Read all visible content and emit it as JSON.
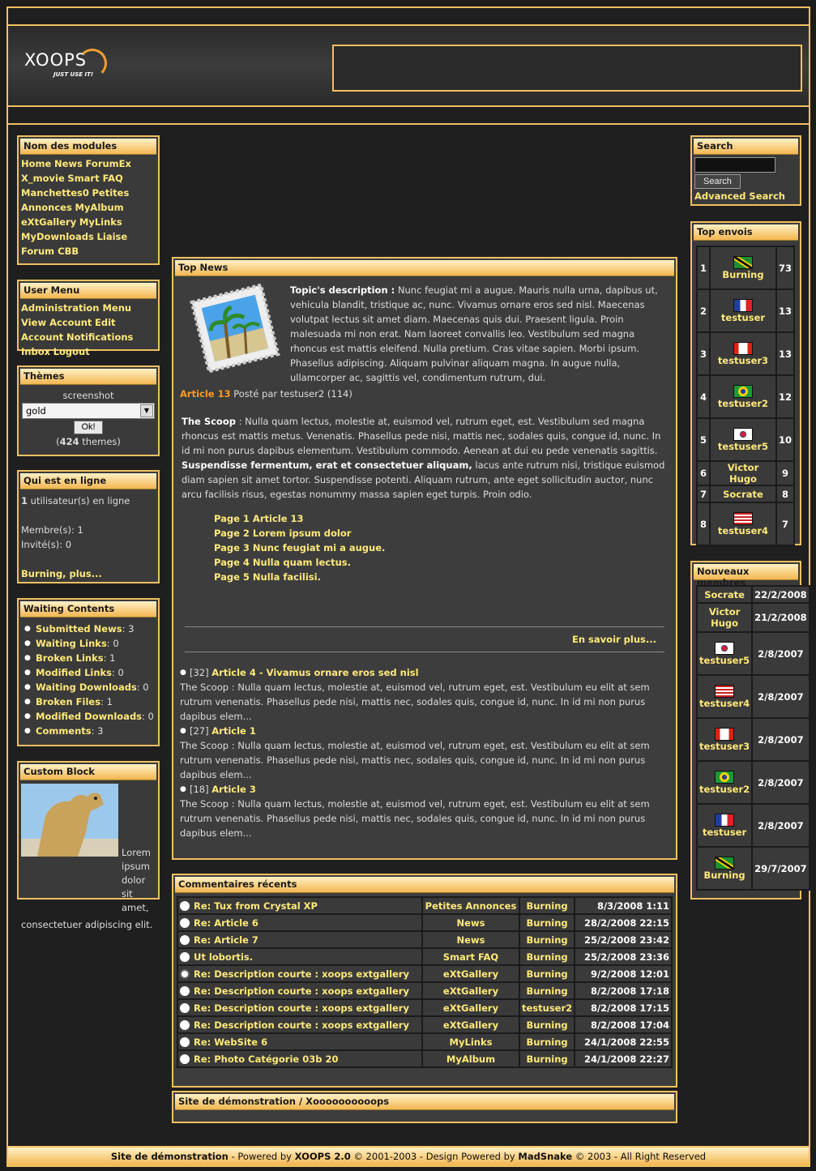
{
  "header": {
    "logo_main": "XOOPS",
    "logo_tag": "JUST USE IT!"
  },
  "modules": {
    "title": "Nom des modules",
    "links": [
      "Home",
      "News",
      "ForumEx",
      "X_movie",
      "Smart FAQ",
      "Manchettes0",
      "Petites Annonces",
      "MyAlbum",
      "eXtGallery",
      "MyLinks",
      "MyDownloads",
      "Liaise",
      "Forum CBB"
    ]
  },
  "user_menu": {
    "title": "User Menu",
    "links": [
      "Administration Menu",
      "View Account",
      "Edit Account",
      "Notifications",
      "Inbox",
      "Logout"
    ]
  },
  "themes": {
    "title": "Thèmes",
    "screenshot_label": "screenshot",
    "selected": "gold",
    "ok_label": "Ok!",
    "count": "424",
    "count_suffix": "themes"
  },
  "online": {
    "title": "Qui est en ligne",
    "count": "1",
    "count_text": "utilisateur(s) en ligne",
    "members": "Membre(s): 1",
    "guests": "Invité(s): 0",
    "more": "Burning, plus..."
  },
  "waiting": {
    "title": "Waiting Contents",
    "items": [
      {
        "label": "Submitted News",
        "value": "3"
      },
      {
        "label": "Waiting Links",
        "value": "0"
      },
      {
        "label": "Broken Links",
        "value": "1"
      },
      {
        "label": "Modified Links",
        "value": "0"
      },
      {
        "label": "Waiting Downloads",
        "value": "0"
      },
      {
        "label": "Broken Files",
        "value": "1"
      },
      {
        "label": "Modified Downloads",
        "value": "0"
      },
      {
        "label": "Comments",
        "value": "3"
      }
    ]
  },
  "custom": {
    "title": "Custom Block",
    "text": "Lorem ipsum dolor sit amet, consectetuer adipiscing elit."
  },
  "top_news": {
    "title": "Top News",
    "topic_label": "Topic's description :",
    "topic_text": "Nunc feugiat mi a augue. Mauris nulla urna, dapibus ut, vehicula blandit, tristique ac, nunc. Vivamus ornare eros sed nisl. Maecenas volutpat lectus sit amet diam. Maecenas quis dui. Praesent ligula. Proin malesuada mi non erat. Nam laoreet convallis leo. Vestibulum sed magna rhoncus est mattis eleifend. Nulla pretium. Cras vitae sapien. Morbi ipsum. Phasellus adipiscing. Aliquam pulvinar aliquam magna. In augue nulla, ullamcorper ac, sagittis vel, condimentum rutrum, dui.",
    "article_title": "Article 13",
    "posted_by": "Posté par testuser2 (114)",
    "scoop_label": "The Scoop",
    "scoop_text_1": ": Nulla quam lectus, molestie at, euismod vel, rutrum eget, est. Vestibulum sed magna rhoncus est mattis metus. Venenatis. Phasellus pede nisi, mattis nec, sodales quis, congue id, nunc. In id mi non purus dapibus elementum. Vestibulum commodo. Aenean at dui eu pede venenatis sagittis.",
    "scoop_bold": "Suspendisse fermentum, erat et consectetuer aliquam,",
    "scoop_text_2": "lacus ante rutrum nisi, tristique euismod diam sapien sit amet tortor. Suspendisse potenti. Aliquam rutrum, ante eget sollicitudin auctor, nunc arcu facilisis risus, egestas nonummy massa sapien eget turpis. Proin odio.",
    "pages": [
      "Page 1 Article 13",
      "Page 2 Lorem ipsum dolor",
      "Page 3 Nunc feugiat mi a augue.",
      "Page 4 Nulla quam lectus.",
      "Page 5 Nulla facilisi."
    ],
    "read_more": "En savoir plus...",
    "others": [
      {
        "count": "[32]",
        "title": "Article 4 - Vivamus ornare eros sed nisl",
        "text": "The Scoop : Nulla quam lectus, molestie at, euismod vel, rutrum eget, est. Vestibulum eu elit at sem rutrum venenatis. Phasellus pede nisi, mattis nec, sodales quis, congue id, nunc. In id mi non purus dapibus elem..."
      },
      {
        "count": "[27]",
        "title": "Article 1",
        "text": "The Scoop : Nulla quam lectus, molestie at, euismod vel, rutrum eget, est. Vestibulum eu elit at sem rutrum venenatis. Phasellus pede nisi, mattis nec, sodales quis, congue id, nunc. In id mi non purus dapibus elem..."
      },
      {
        "count": "[18]",
        "title": "Article 3",
        "text": "The Scoop : Nulla quam lectus, molestie at, euismod vel, rutrum eget, est. Vestibulum eu elit at sem rutrum venenatis. Phasellus pede nisi, mattis nec, sodales quis, congue id, nunc. In id mi non purus dapibus elem..."
      }
    ]
  },
  "comments": {
    "title": "Commentaires récents",
    "rows": [
      {
        "title": "Re: Tux from Crystal XP",
        "module": "Petites Annonces",
        "user": "Burning",
        "date": "8/3/2008 1:11",
        "icon": "circle"
      },
      {
        "title": "Re: Article 6",
        "module": "News",
        "user": "Burning",
        "date": "28/2/2008 22:15",
        "icon": "circle"
      },
      {
        "title": "Re: Article 7",
        "module": "News",
        "user": "Burning",
        "date": "25/2/2008 23:42",
        "icon": "circle"
      },
      {
        "title": "Ut lobortis.",
        "module": "Smart FAQ",
        "user": "Burning",
        "date": "25/2/2008 23:36",
        "icon": "circle"
      },
      {
        "title": "Re: Description courte : xoops extgallery",
        "module": "eXtGallery",
        "user": "Burning",
        "date": "9/2/2008 12:01",
        "icon": "smiley"
      },
      {
        "title": "Re: Description courte : xoops extgallery",
        "module": "eXtGallery",
        "user": "Burning",
        "date": "8/2/2008 17:18",
        "icon": "circle"
      },
      {
        "title": "Re: Description courte : xoops extgallery",
        "module": "eXtGallery",
        "user": "testuser2",
        "date": "8/2/2008 17:15",
        "icon": "circle"
      },
      {
        "title": "Re: Description courte : xoops extgallery",
        "module": "eXtGallery",
        "user": "Burning",
        "date": "8/2/2008 17:04",
        "icon": "circle"
      },
      {
        "title": "Re: WebSite 6",
        "module": "MyLinks",
        "user": "Burning",
        "date": "24/1/2008 22:55",
        "icon": "circle"
      },
      {
        "title": "Re: Photo Catégorie 03b 20",
        "module": "MyAlbum",
        "user": "Burning",
        "date": "24/1/2008 22:27",
        "icon": "circle"
      }
    ]
  },
  "demo": {
    "title": "Site de démonstration / Xoooooooooops"
  },
  "search": {
    "title": "Search",
    "button": "Search",
    "advanced": "Advanced Search"
  },
  "top_posters": {
    "title": "Top envois",
    "rows": [
      {
        "rank": "1",
        "name": "Burning",
        "posts": "73",
        "flag": "jamaica"
      },
      {
        "rank": "2",
        "name": "testuser",
        "posts": "13",
        "flag": "france"
      },
      {
        "rank": "3",
        "name": "testuser3",
        "posts": "13",
        "flag": "canada"
      },
      {
        "rank": "4",
        "name": "testuser2",
        "posts": "12",
        "flag": "brazil"
      },
      {
        "rank": "5",
        "name": "testuser5",
        "posts": "10",
        "flag": "korea"
      },
      {
        "rank": "6",
        "name": "Victor Hugo",
        "posts": "9",
        "flag": ""
      },
      {
        "rank": "7",
        "name": "Socrate",
        "posts": "8",
        "flag": ""
      },
      {
        "rank": "8",
        "name": "testuser4",
        "posts": "7",
        "flag": "usa"
      }
    ]
  },
  "new_members": {
    "title": "Nouveaux membres",
    "rows": [
      {
        "name": "Socrate",
        "date": "22/2/2008",
        "flag": ""
      },
      {
        "name": "Victor Hugo",
        "date": "21/2/2008",
        "flag": ""
      },
      {
        "name": "testuser5",
        "date": "2/8/2007",
        "flag": "korea"
      },
      {
        "name": "testuser4",
        "date": "2/8/2007",
        "flag": "usa"
      },
      {
        "name": "testuser3",
        "date": "2/8/2007",
        "flag": "canada"
      },
      {
        "name": "testuser2",
        "date": "2/8/2007",
        "flag": "brazil"
      },
      {
        "name": "testuser",
        "date": "2/8/2007",
        "flag": "france"
      },
      {
        "name": "Burning",
        "date": "29/7/2007",
        "flag": "jamaica"
      }
    ]
  },
  "footer": {
    "site": "Site de démonstration",
    "powered": " - Powered by ",
    "xoops": "XOOPS 2.0",
    "years": " © 2001-2003 - Design Powered by ",
    "madsnake": "MadSnake",
    "rest": " © 2003 - All Right Reserved"
  },
  "colors": {
    "accent": "#f0c060",
    "link": "#ffe97a",
    "article": "#ff9922"
  }
}
